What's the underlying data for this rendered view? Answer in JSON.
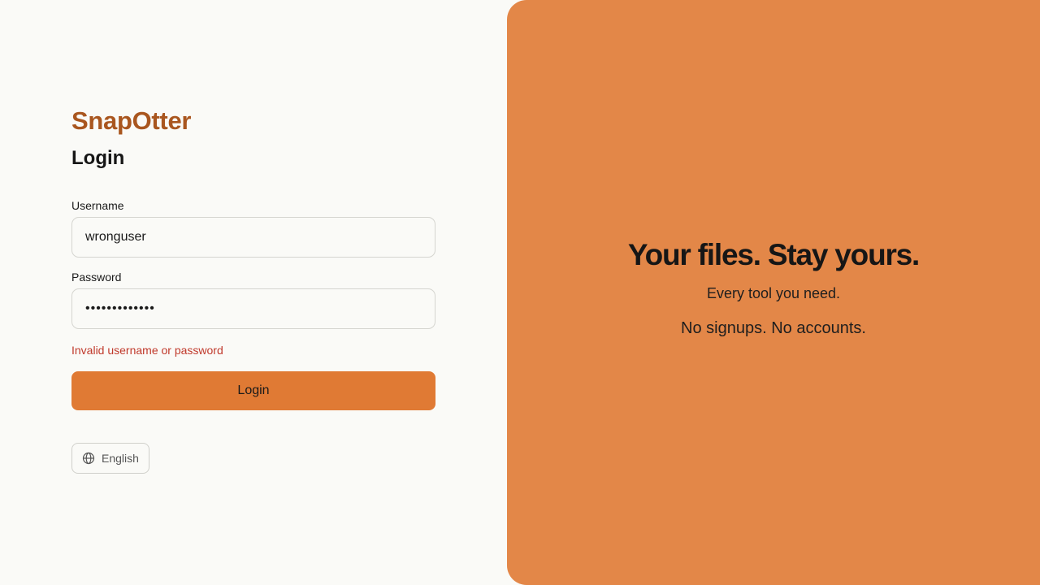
{
  "brand": {
    "name": "SnapOtter",
    "color": "#a9561f"
  },
  "form": {
    "heading": "Login",
    "username_label": "Username",
    "username_value": "wronguser",
    "password_label": "Password",
    "password_value": "•••••••••••••",
    "error": "Invalid username or password",
    "submit_label": "Login"
  },
  "language": {
    "label": "English",
    "icon": "globe-icon"
  },
  "hero": {
    "title": "Your files. Stay yours.",
    "subtitle": "Every tool you need.",
    "tagline": "No signups. No accounts.",
    "background": "#e38748"
  },
  "colors": {
    "accent": "#e07a34",
    "error": "#c0392b"
  }
}
